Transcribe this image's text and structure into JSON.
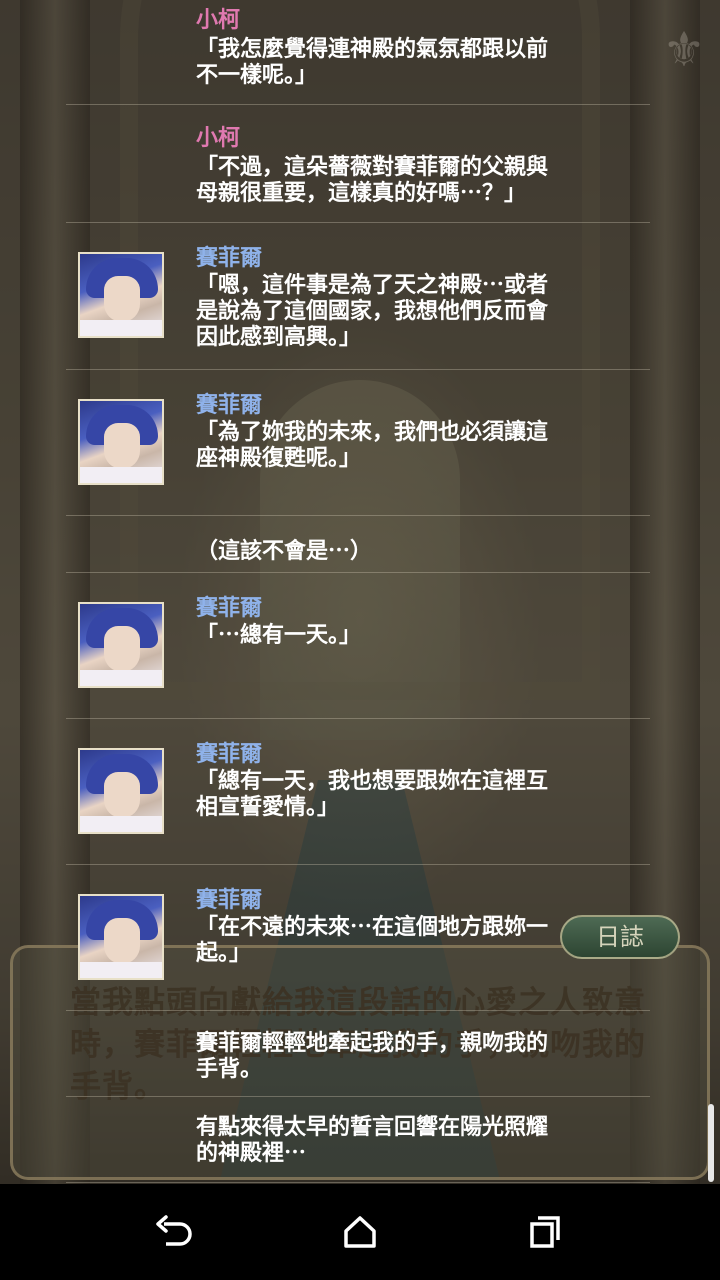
{
  "background": {
    "message_text": "當我點頭向獻給我這段話的心愛之人致意時，賽菲爾輕輕地牽起我的手，親吻我的手背。",
    "log_button_label": "日誌"
  },
  "log": {
    "entries": [
      {
        "speaker": "小柯",
        "speaker_color": "#e079b0",
        "has_avatar": false,
        "text": "「我怎麼覺得連神殿的氣氛都跟以前\n不一樣呢。」"
      },
      {
        "speaker": "小柯",
        "speaker_color": "#e079b0",
        "has_avatar": false,
        "text": "「不過，這朵薔薇對賽菲爾的父親與\n母親很重要，這樣真的好嗎⋯？」"
      },
      {
        "speaker": "賽菲爾",
        "speaker_color": "#8fb2ea",
        "has_avatar": true,
        "text": "「嗯，這件事是為了天之神殿⋯或者\n是說為了這個國家，我想他們反而會\n因此感到高興。」"
      },
      {
        "speaker": "賽菲爾",
        "speaker_color": "#8fb2ea",
        "has_avatar": true,
        "text": "「為了妳我的未來，我們也必須讓這\n座神殿復甦呢。」"
      },
      {
        "speaker": "",
        "has_avatar": false,
        "text": "（這該不會是⋯）"
      },
      {
        "speaker": "賽菲爾",
        "speaker_color": "#8fb2ea",
        "has_avatar": true,
        "text": "「⋯總有一天。」"
      },
      {
        "speaker": "賽菲爾",
        "speaker_color": "#8fb2ea",
        "has_avatar": true,
        "text": "「總有一天，我也想要跟妳在這裡互\n相宣誓愛情。」"
      },
      {
        "speaker": "賽菲爾",
        "speaker_color": "#8fb2ea",
        "has_avatar": true,
        "text": "「在不遠的未來⋯在這個地方跟妳一\n起。」"
      },
      {
        "speaker": "",
        "has_avatar": false,
        "text": "賽菲爾輕輕地牽起我的手，親吻我的\n手背。"
      },
      {
        "speaker": "",
        "has_avatar": false,
        "text": "有點來得太早的誓言回響在陽光照耀\n的神殿裡⋯"
      }
    ]
  },
  "navbar": {
    "back_icon": "back-icon",
    "home_icon": "home-icon",
    "recents_icon": "recents-icon"
  }
}
